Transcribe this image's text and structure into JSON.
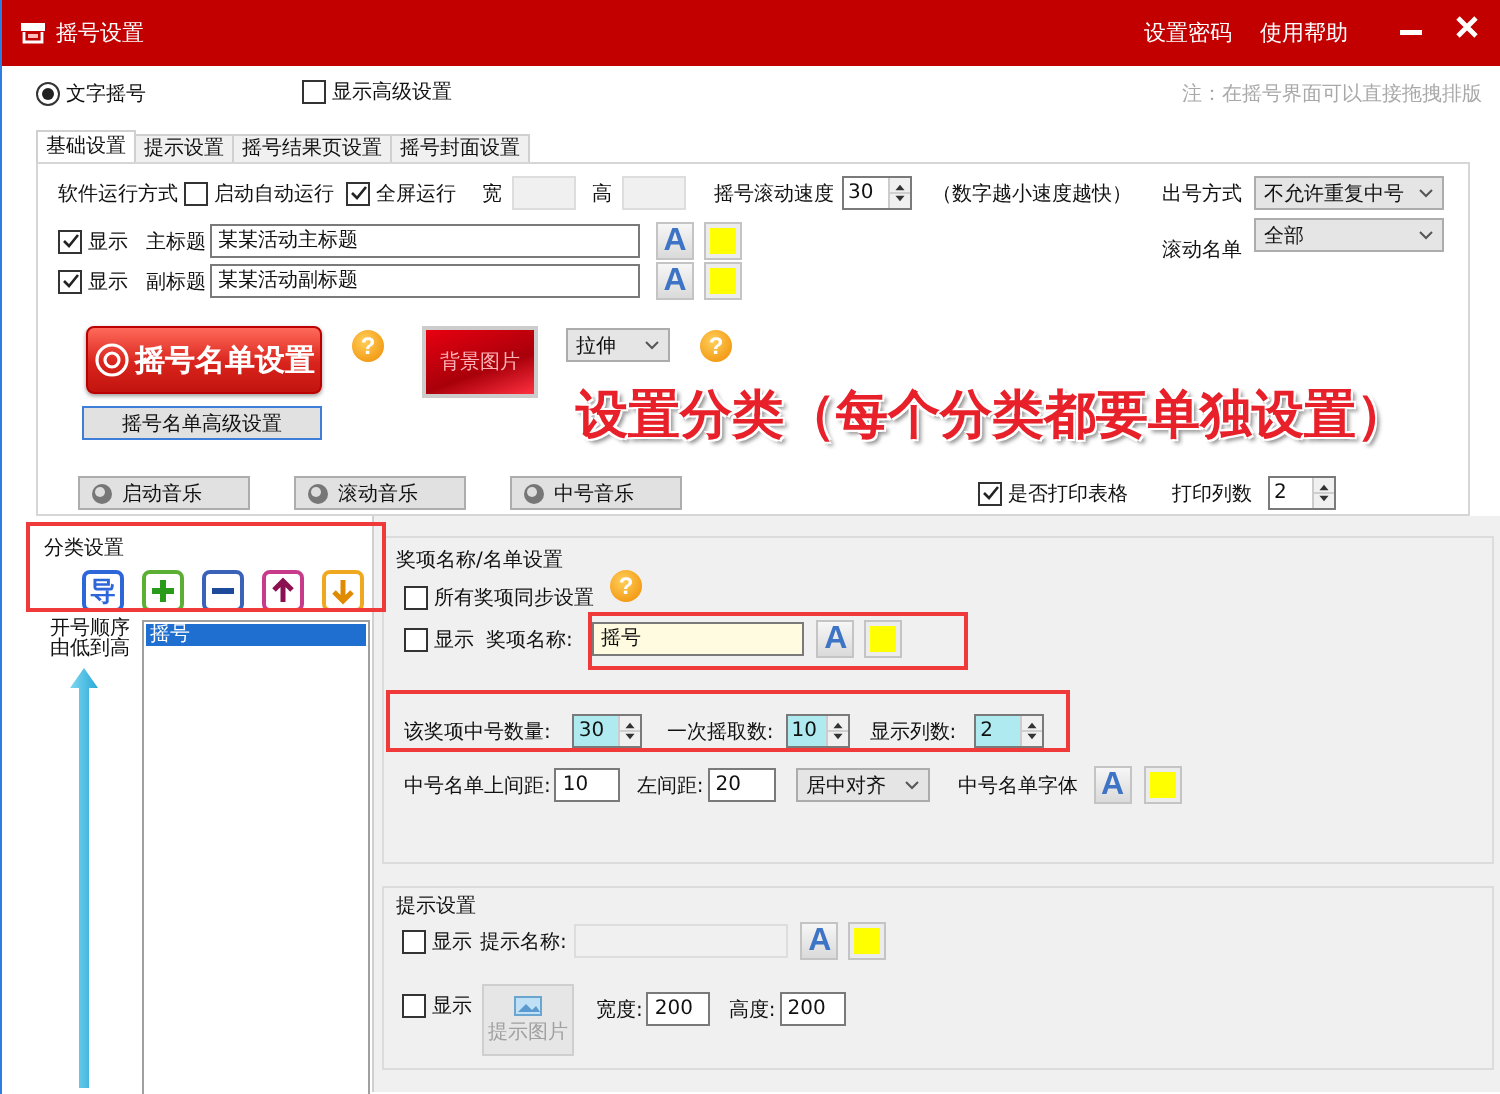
{
  "window": {
    "title": "摇号设置",
    "links": [
      "设置密码",
      "使用帮助"
    ]
  },
  "mode": {
    "label": "文字摇号",
    "selected": true
  },
  "advanced": {
    "label": "显示高级设置",
    "checked": false
  },
  "note": "注：在摇号界面可以直接拖拽排版",
  "tabs": [
    {
      "label": "基础设置",
      "selected": true
    },
    {
      "label": "提示设置",
      "selected": false
    },
    {
      "label": "摇号结果页设置",
      "selected": false
    },
    {
      "label": "摇号封面设置",
      "selected": false
    }
  ],
  "run_mode": {
    "label": "软件运行方式",
    "options": [
      {
        "label": "启动自动运行",
        "checked": false
      },
      {
        "label": "全屏运行",
        "checked": true
      }
    ],
    "width_label": "宽",
    "height_label": "高"
  },
  "scroll_speed": {
    "label": "摇号滚动速度",
    "value": "30",
    "hint": "（数字越小速度越快）"
  },
  "draw_mode": {
    "label": "出号方式",
    "value": "不允许重复中号"
  },
  "scroll_list": {
    "label": "滚动名单",
    "value": "全部"
  },
  "titles": [
    {
      "show_label": "显示",
      "checked": true,
      "label": "主标题",
      "value": "某某活动主标题",
      "font_button": "A"
    },
    {
      "show_label": "显示",
      "checked": true,
      "label": "副标题",
      "value": "某某活动副标题",
      "font_button": "A"
    }
  ],
  "list_button": {
    "label": "摇号名单设置",
    "help": "?"
  },
  "background_button": "背景图片",
  "stretch": {
    "value": "拉伸",
    "help": "?"
  },
  "advanced_list_button": "摇号名单高级设置",
  "overlay_caption": "设置分类（每个分类都要单独设置）",
  "print_table": {
    "label": "是否打印表格",
    "checked": true
  },
  "print_columns": {
    "label": "打印列数",
    "value": "2"
  },
  "music_buttons": [
    "启动音乐",
    "滚动音乐",
    "中号音乐"
  ],
  "category": {
    "title": "分类设置",
    "import_button": "导",
    "order_lines": [
      "开号顺序",
      "由低到高"
    ],
    "items": [
      {
        "label": "摇号",
        "selected": true
      }
    ]
  },
  "prize": {
    "title": "奖项名称/名单设置",
    "help": "?",
    "sync": {
      "label": "所有奖项同步设置",
      "checked": false
    },
    "show": {
      "label": "显示",
      "checked": false
    },
    "name_label": "奖项名称:",
    "name_value": "摇号",
    "font_button": "A",
    "counts": [
      {
        "label": "该奖项中号数量:",
        "value": "30"
      },
      {
        "label": "一次摇取数:",
        "value": "10"
      },
      {
        "label": "显示列数:",
        "value": "2"
      }
    ],
    "top_margin": {
      "label": "中号名单上间距:",
      "value": "10"
    },
    "left_margin": {
      "label": "左间距:",
      "value": "20"
    },
    "align": "居中对齐",
    "list_font_label": "中号名单字体",
    "list_font_button": "A"
  },
  "tip": {
    "title": "提示设置",
    "show_name": {
      "label": "显示",
      "checked": false
    },
    "name_label": "提示名称:",
    "font_button": "A",
    "show_image": {
      "label": "显示",
      "checked": false
    },
    "image_button": "提示图片",
    "width": {
      "label": "宽度:",
      "value": "200"
    },
    "height": {
      "label": "高度:",
      "value": "200"
    }
  }
}
